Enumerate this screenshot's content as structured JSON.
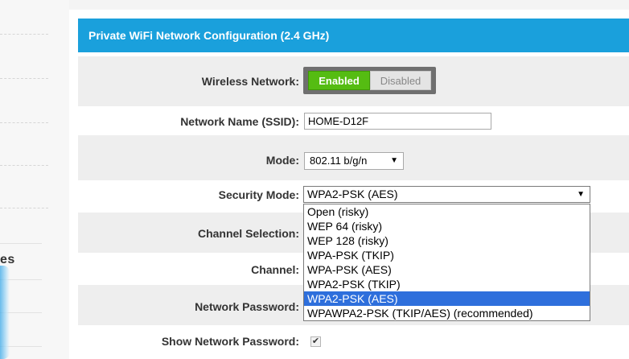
{
  "sidebar": {
    "partial_label": "es"
  },
  "panel": {
    "title": "Private WiFi Network Configuration (2.4 GHz)"
  },
  "wireless": {
    "label": "Wireless Network:",
    "enabled_label": "Enabled",
    "disabled_label": "Disabled",
    "state": "Enabled"
  },
  "ssid": {
    "label": "Network Name (SSID):",
    "value": "HOME-D12F"
  },
  "mode": {
    "label": "Mode:",
    "value": "802.11 b/g/n"
  },
  "security": {
    "label": "Security Mode:",
    "value": "WPA2-PSK (AES)",
    "options": [
      "Open (risky)",
      "WEP 64 (risky)",
      "WEP 128 (risky)",
      "WPA-PSK (TKIP)",
      "WPA-PSK (AES)",
      "WPA2-PSK (TKIP)",
      "WPA2-PSK (AES)",
      "WPAWPA2-PSK (TKIP/AES) (recommended)"
    ],
    "highlighted_index": 6
  },
  "channel_selection": {
    "label": "Channel Selection:"
  },
  "channel": {
    "label": "Channel:"
  },
  "password": {
    "label": "Network Password:"
  },
  "show_password": {
    "label": "Show Network Password:",
    "checked": true,
    "check_glyph": "✔"
  },
  "colors": {
    "header_bg": "#1aa0dc",
    "enabled_green": "#55bc12",
    "selection_blue": "#2e6fdc"
  }
}
